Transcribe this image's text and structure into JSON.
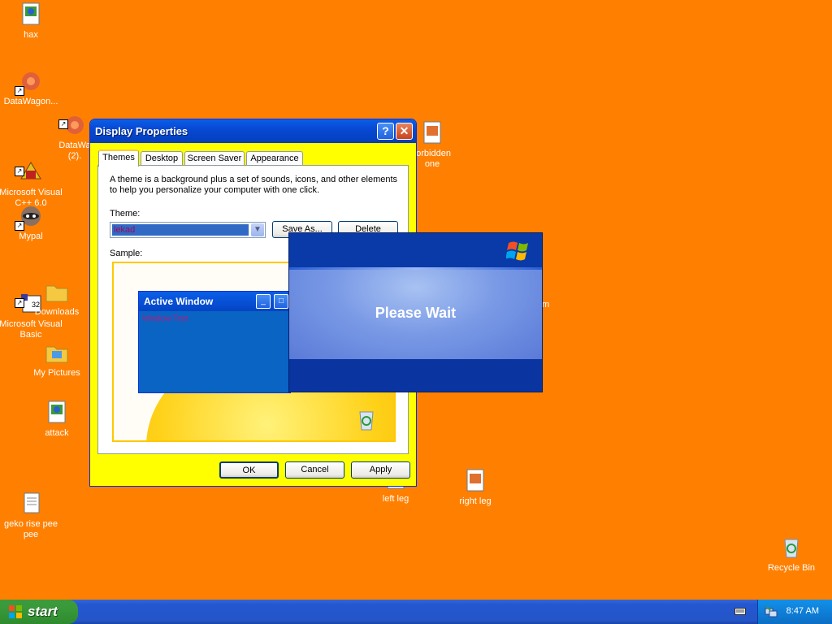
{
  "desktop": {
    "icons": [
      {
        "label": "hax"
      },
      {
        "label": "DataWagon..."
      },
      {
        "label": "DataWa\n(2)."
      },
      {
        "label": "Microsoft Visual\nC++ 6.0"
      },
      {
        "label": "Mypal"
      },
      {
        "label": "Microsoft Visual\nBasic"
      },
      {
        "label": "Downloads"
      },
      {
        "label": "My Pictures"
      },
      {
        "label": "attack"
      },
      {
        "label": "geko rise pee\npee"
      },
      {
        "label": "forbidden\none"
      },
      {
        "label": "left leg"
      },
      {
        "label": "right leg"
      },
      {
        "label": "m"
      },
      {
        "label": "Recycle Bin"
      }
    ]
  },
  "display_properties": {
    "title": "Display Properties",
    "help_glyph": "?",
    "close_glyph": "✕",
    "tabs": [
      {
        "label": "Themes"
      },
      {
        "label": "Desktop"
      },
      {
        "label": "Screen Saver"
      },
      {
        "label": "Appearance"
      }
    ],
    "description": "A theme is a background plus a set of sounds, icons, and other elements to help you personalize your computer with one click.",
    "theme_label": "Theme:",
    "theme_value": "lekad",
    "save_as_label": "Save As...",
    "delete_label": "Delete",
    "sample_label": "Sample:",
    "sample": {
      "active_window_title": "Active Window",
      "window_text": "Window Text"
    },
    "ok_label": "OK",
    "cancel_label": "Cancel",
    "apply_label": "Apply"
  },
  "please_wait": {
    "message": "Please Wait"
  },
  "taskbar": {
    "start_label": "start",
    "clock": "8:47 AM"
  }
}
